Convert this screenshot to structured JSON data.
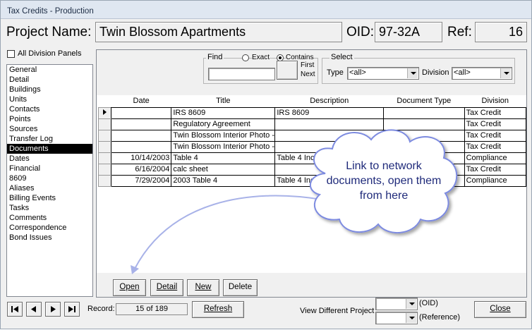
{
  "window": {
    "title": "Tax Credits - Production"
  },
  "header": {
    "project_label": "Project Name:",
    "project_name": "Twin Blossom Apartments",
    "oid_label": "OID:",
    "oid_value": "97-32A",
    "ref_label": "Ref:",
    "ref_value": "16"
  },
  "sidebar": {
    "all_panels_label": "All Division Panels",
    "all_panels_checked": false,
    "items": [
      {
        "label": "General"
      },
      {
        "label": "Detail"
      },
      {
        "label": "Buildings"
      },
      {
        "label": "Units"
      },
      {
        "label": "Contacts"
      },
      {
        "label": "Points"
      },
      {
        "label": "Sources"
      },
      {
        "label": "Transfer Log"
      },
      {
        "label": "Documents",
        "selected": true
      },
      {
        "label": "Dates"
      },
      {
        "label": "Financial"
      },
      {
        "label": "8609"
      },
      {
        "label": "Aliases"
      },
      {
        "label": "Billing Events"
      },
      {
        "label": "Tasks"
      },
      {
        "label": "Comments"
      },
      {
        "label": "Correspondence"
      },
      {
        "label": "Bond Issues"
      }
    ]
  },
  "find": {
    "label": "Find",
    "exact_label": "Exact",
    "contains_label": "Contains",
    "selected_mode": "Contains",
    "value": "",
    "first_label": "First",
    "next_label": "Next"
  },
  "select": {
    "label": "Select",
    "type_label": "Type",
    "type_value": "<all>",
    "division_label": "Division",
    "division_value": "<all>"
  },
  "table": {
    "columns": [
      "Date",
      "Title",
      "Description",
      "Document Type",
      "Division"
    ],
    "rows": [
      {
        "date": "",
        "title": "IRS 8609",
        "description": "IRS 8609",
        "doc_type": "",
        "division": "Tax Credit",
        "current": true
      },
      {
        "date": "",
        "title": "Regulatory Agreement",
        "description": "",
        "doc_type": "",
        "division": "Tax Credit"
      },
      {
        "date": "",
        "title": "Twin Blossom Interior Photo - U",
        "description": "",
        "doc_type": "",
        "division": "Tax Credit"
      },
      {
        "date": "",
        "title": "Twin Blossom Interior Photo - U",
        "description": "",
        "doc_type": "",
        "division": "Tax Credit"
      },
      {
        "date": "10/14/2003",
        "title": "Table 4",
        "description": "Table 4 Inco",
        "doc_type": "",
        "division": "Compliance"
      },
      {
        "date": "6/16/2004",
        "title": "calc sheet",
        "description": "",
        "doc_type": "",
        "division": "Tax Credit"
      },
      {
        "date": "7/29/2004",
        "title": "2003 Table 4",
        "description": "Table 4 Inc",
        "doc_type": "",
        "division": "Compliance"
      }
    ]
  },
  "actions": {
    "open": "Open",
    "detail": "Detail",
    "new": "New",
    "delete": "Delete"
  },
  "callout": {
    "text": "Link to network documents, open them from here"
  },
  "footer": {
    "record_label": "Record:",
    "record_value": "15 of 189",
    "refresh_label": "Refresh",
    "view_project_label": "View Different Project",
    "oid_hint": "(OID)",
    "reference_hint": "(Reference)",
    "close_label": "Close"
  }
}
